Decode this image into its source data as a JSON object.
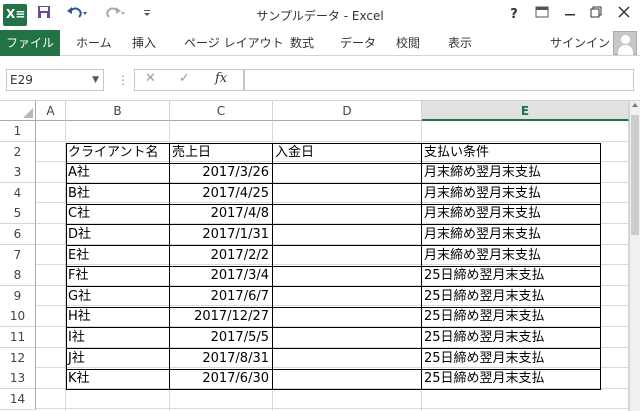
{
  "window": {
    "title": "サンプルデータ - Excel"
  },
  "qat": {
    "save_icon": "save-icon",
    "undo_icon": "undo-icon",
    "redo_icon": "redo-icon",
    "customize_icon": "customize-icon"
  },
  "window_controls": {
    "help": "?",
    "display_options": "display-options-icon",
    "minimize": "minimize-icon",
    "restore": "restore-icon",
    "close": "close-icon"
  },
  "ribbon": {
    "file_tab": "ファイル",
    "tabs": [
      "ホーム",
      "挿入",
      "ページ レイアウト",
      "数式",
      "データ",
      "校閲",
      "表示"
    ],
    "signin": "サインイン"
  },
  "formula_bar": {
    "name_box": "E29",
    "fx_label": "fx",
    "formula": ""
  },
  "columns": [
    "A",
    "B",
    "C",
    "D",
    "E"
  ],
  "selected_column": "E",
  "rows": [
    "1",
    "2",
    "3",
    "4",
    "5",
    "6",
    "7",
    "8",
    "9",
    "10",
    "11",
    "12",
    "13",
    "14"
  ],
  "table": {
    "headers": {
      "client": "クライアント名",
      "sales_date": "売上日",
      "payment_date": "入金日",
      "terms": "支払い条件"
    },
    "records": [
      {
        "client": "A社",
        "sales_date": "2017/3/26",
        "payment_date": "",
        "terms": "月末締め翌月末支払"
      },
      {
        "client": "B社",
        "sales_date": "2017/4/25",
        "payment_date": "",
        "terms": "月末締め翌月末支払"
      },
      {
        "client": "C社",
        "sales_date": "2017/4/8",
        "payment_date": "",
        "terms": "月末締め翌月末支払"
      },
      {
        "client": "D社",
        "sales_date": "2017/1/31",
        "payment_date": "",
        "terms": "月末締め翌月末支払"
      },
      {
        "client": "E社",
        "sales_date": "2017/2/2",
        "payment_date": "",
        "terms": "月末締め翌月末支払"
      },
      {
        "client": "F社",
        "sales_date": "2017/3/4",
        "payment_date": "",
        "terms": "25日締め翌月末支払"
      },
      {
        "client": "G社",
        "sales_date": "2017/6/7",
        "payment_date": "",
        "terms": "25日締め翌月末支払"
      },
      {
        "client": "H社",
        "sales_date": "2017/12/27",
        "payment_date": "",
        "terms": "25日締め翌月末支払"
      },
      {
        "client": "I社",
        "sales_date": "2017/5/5",
        "payment_date": "",
        "terms": "25日締め翌月末支払"
      },
      {
        "client": "J社",
        "sales_date": "2017/8/31",
        "payment_date": "",
        "terms": "25日締め翌月末支払"
      },
      {
        "client": "K社",
        "sales_date": "2017/6/30",
        "payment_date": "",
        "terms": "25日締め翌月末支払"
      }
    ]
  },
  "colors": {
    "accent": "#217346",
    "grid": "#d9d9d9",
    "header_selected_bg": "#e1e1e1"
  }
}
